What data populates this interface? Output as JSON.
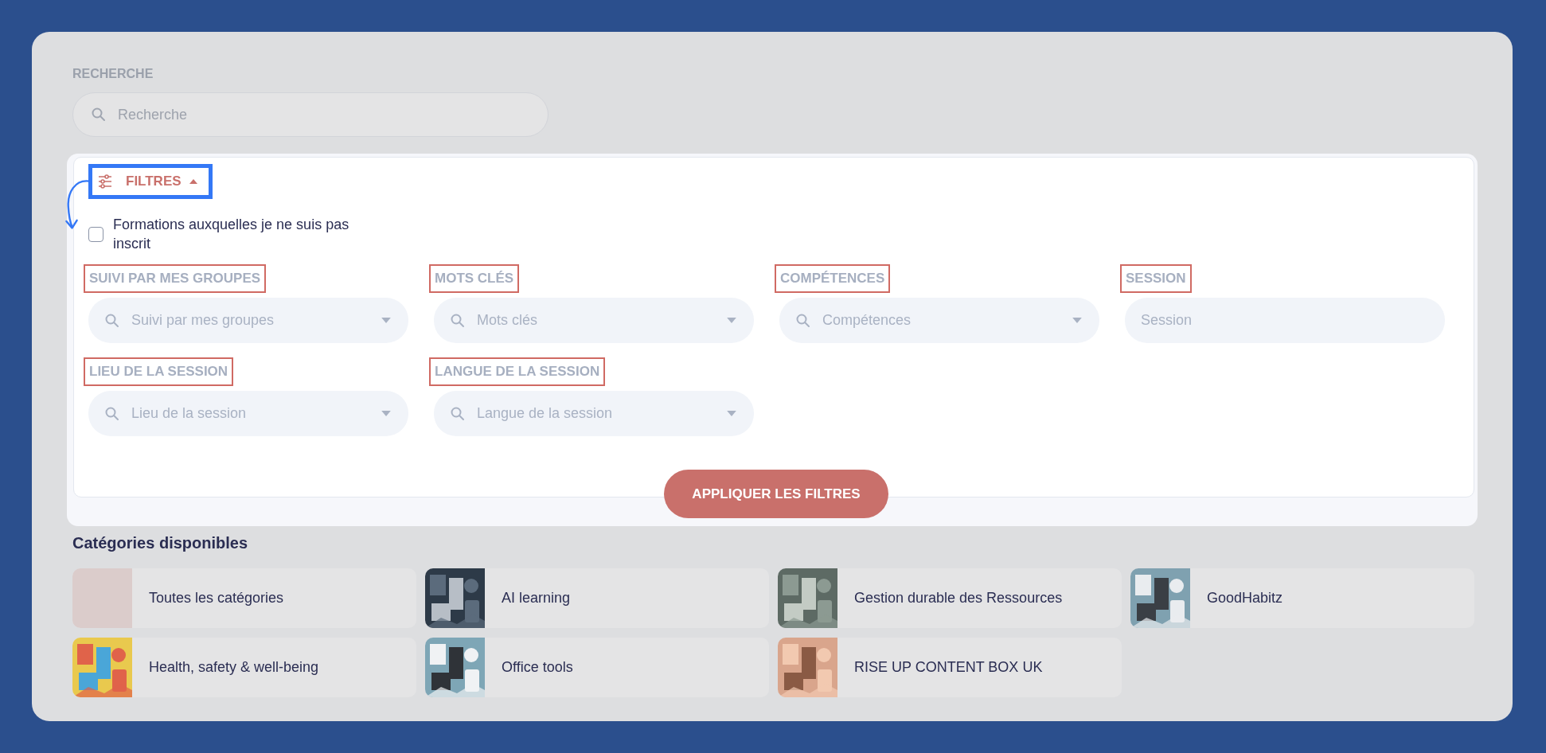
{
  "search": {
    "label": "RECHERCHE",
    "placeholder": "Recherche"
  },
  "filters": {
    "toggle": {
      "label": "FILTRES",
      "expanded": true,
      "highlighted": true
    },
    "checkbox": {
      "label": "Formations auxquelles je ne suis pas inscrit",
      "checked": false
    },
    "fields": [
      {
        "label": "SUIVI PAR MES GROUPES",
        "placeholder": "Suivi par mes groupes",
        "kind": "select",
        "highlighted": true
      },
      {
        "label": "MOTS CLÉS",
        "placeholder": "Mots clés",
        "kind": "select",
        "highlighted": true
      },
      {
        "label": "COMPÉTENCES",
        "placeholder": "Compétences",
        "kind": "select",
        "highlighted": true
      },
      {
        "label": "SESSION",
        "placeholder": "Session",
        "kind": "text",
        "highlighted": true
      },
      {
        "label": "LIEU DE LA SESSION",
        "placeholder": "Lieu de la session",
        "kind": "select",
        "highlighted": true
      },
      {
        "label": "LANGUE DE LA SESSION",
        "placeholder": "Langue de la session",
        "kind": "select",
        "highlighted": true
      }
    ],
    "apply_button": "APPLIQUER LES FILTRES"
  },
  "categories": {
    "title": "Catégories disponibles",
    "items": [
      {
        "name": "Toutes les catégories",
        "kind": "swatch",
        "color": "#dbcccb"
      },
      {
        "name": "AI learning",
        "kind": "picture"
      },
      {
        "name": "Gestion durable des Ressources",
        "kind": "picture"
      },
      {
        "name": "GoodHabitz",
        "kind": "picture"
      },
      {
        "name": "Health, safety & well-being",
        "kind": "picture"
      },
      {
        "name": "Office tools",
        "kind": "picture"
      },
      {
        "name": "RISE UP CONTENT BOX UK",
        "kind": "picture"
      }
    ]
  }
}
